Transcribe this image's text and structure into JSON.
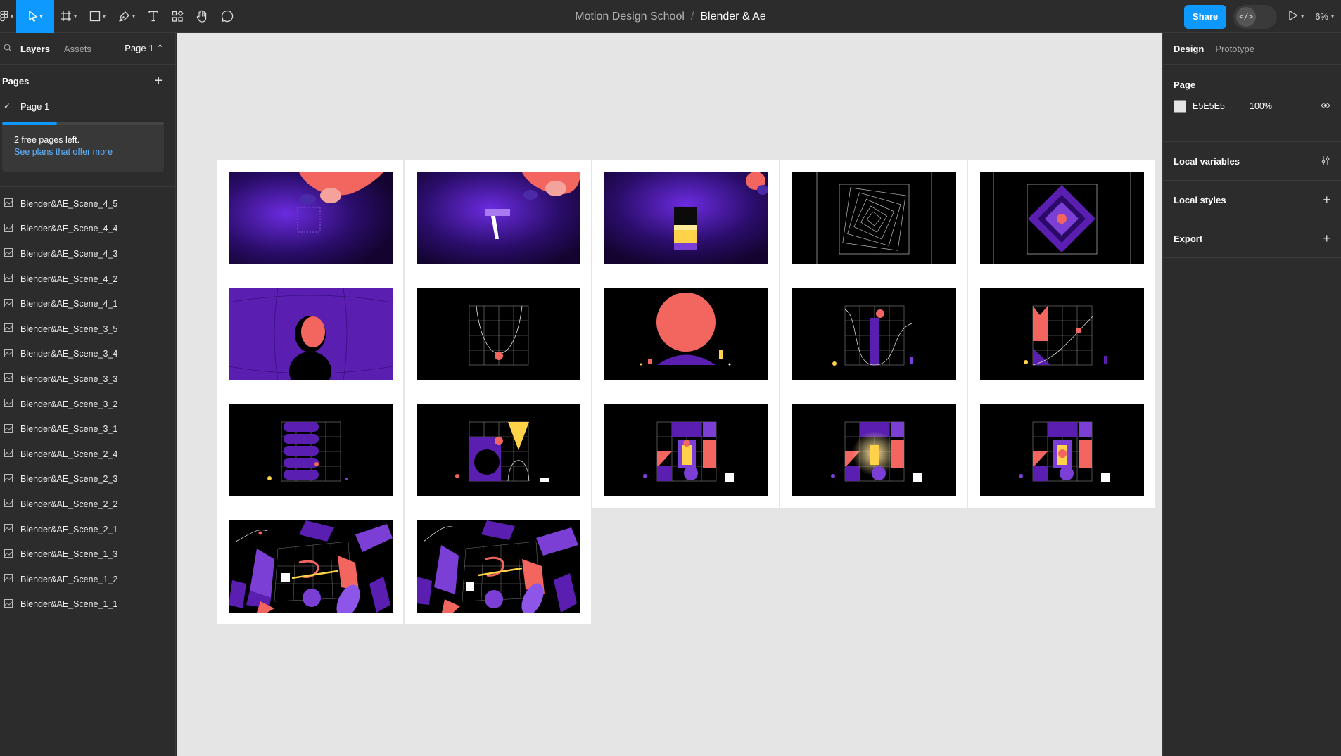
{
  "toolbar": {
    "project": "Motion Design School",
    "separator": "/",
    "file": "Blender & Ae",
    "share_label": "Share",
    "devmode_label": "</>",
    "zoom": "6%"
  },
  "left_panel": {
    "tabs": [
      "Layers",
      "Assets"
    ],
    "page_selector": "Page 1 ⌃",
    "pages_title": "Pages",
    "pages": [
      "Page 1"
    ],
    "free_pages_text": "2 free pages left.",
    "plans_link": "See plans that offer more",
    "layers": [
      "Blender&AE_Scene_4_5",
      "Blender&AE_Scene_4_4",
      "Blender&AE_Scene_4_3",
      "Blender&AE_Scene_4_2",
      "Blender&AE_Scene_4_1",
      "Blender&AE_Scene_3_5",
      "Blender&AE_Scene_3_4",
      "Blender&AE_Scene_3_3",
      "Blender&AE_Scene_3_2",
      "Blender&AE_Scene_3_1",
      "Blender&AE_Scene_2_4",
      "Blender&AE_Scene_2_3",
      "Blender&AE_Scene_2_2",
      "Blender&AE_Scene_2_1",
      "Blender&AE_Scene_1_3",
      "Blender&AE_Scene_1_2",
      "Blender&AE_Scene_1_1"
    ]
  },
  "right_panel": {
    "tabs": [
      "Design",
      "Prototype"
    ],
    "page_title": "Page",
    "page_color": "E5E5E5",
    "page_opacity": "100%",
    "local_variables": "Local variables",
    "local_styles": "Local styles",
    "export": "Export"
  },
  "colors": {
    "accent": "#0d99ff",
    "canvas": "#e5e5e5",
    "coral": "#f2665f",
    "purple": "#5a1fb0",
    "violet": "#7b3fd6",
    "gold": "#ffd24a",
    "black": "#000000"
  },
  "icons": [
    "figma-menu-icon",
    "move-tool-icon",
    "frame-tool-icon",
    "shape-tool-icon",
    "pen-tool-icon",
    "text-tool-icon",
    "resources-icon",
    "hand-tool-icon",
    "comment-tool-icon",
    "present-icon",
    "search-icon",
    "plus-icon",
    "check-icon",
    "frame-layer-icon",
    "eye-icon",
    "variables-icon"
  ]
}
